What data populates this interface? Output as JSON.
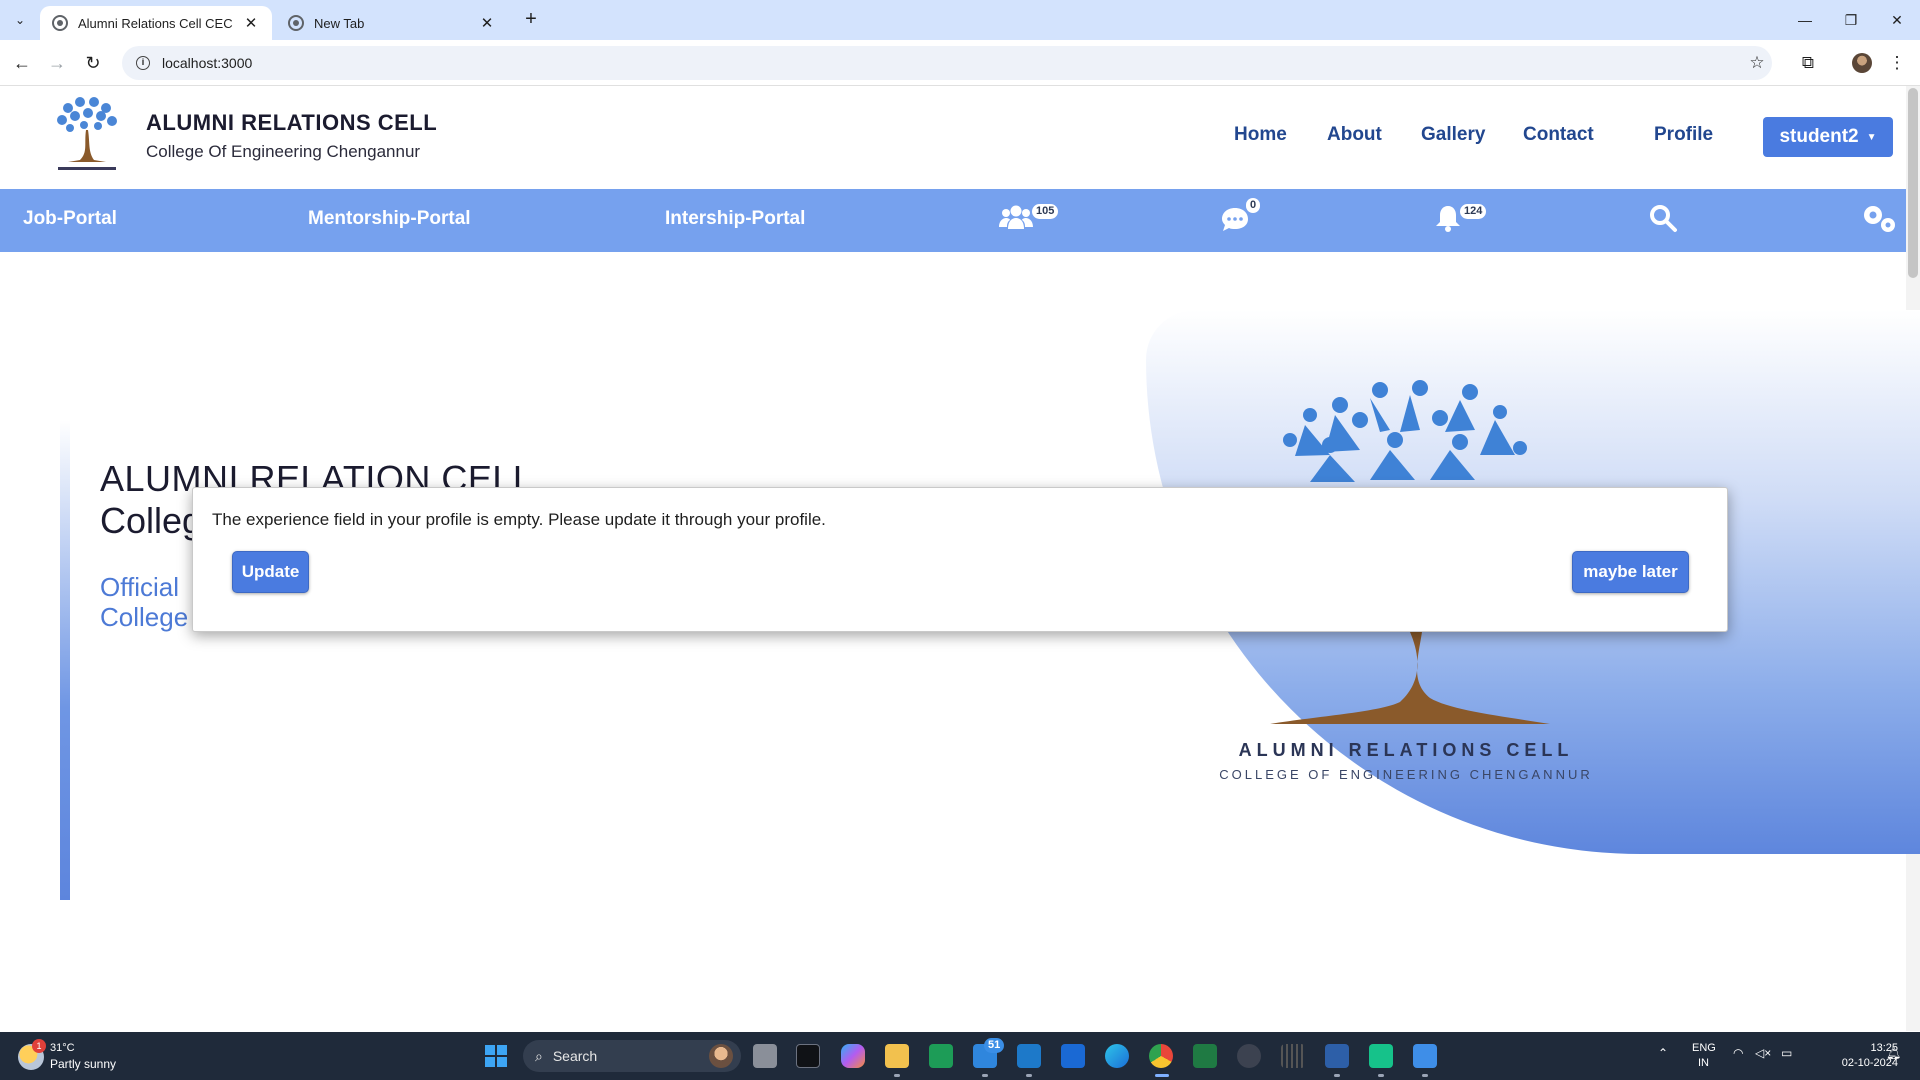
{
  "browser": {
    "tabs": [
      {
        "title": "Alumni Relations Cell CEC",
        "active": true
      },
      {
        "title": "New Tab",
        "active": false
      }
    ],
    "tab_close": "✕",
    "new_tab": "+",
    "url": "localhost:3000",
    "window_controls": {
      "minimize": "—",
      "restore": "❐",
      "close": "✕"
    }
  },
  "site": {
    "brand_title": "ALUMNI RELATIONS CELL",
    "brand_subtitle": "College Of Engineering Chengannur",
    "nav": [
      "Home",
      "About",
      "Gallery",
      "Contact",
      "Profile"
    ],
    "user_button": "student2",
    "portal_links": [
      "Job-Portal",
      "Mentorship-Portal",
      "Intership-Portal"
    ],
    "badges": {
      "connections": "105",
      "messages": "0",
      "notifications": "124"
    }
  },
  "hero": {
    "title": "ALUMNI RELATION CELL",
    "subtitle_partial": "Colleg",
    "desc_line1_partial": "Official",
    "desc_line2_partial": "College",
    "logo_title": "ALUMNI RELATIONS CELL",
    "logo_subtitle": "COLLEGE OF ENGINEERING CHENGANNUR"
  },
  "modal": {
    "message": "The experience field in your profile is empty. Please update it through your profile.",
    "update_button": "Update",
    "later_button": "maybe later"
  },
  "taskbar": {
    "weather_temp": "31°C",
    "weather_condition": "Partly sunny",
    "weather_badge": "1",
    "search_label": "Search",
    "mail_badge": "51",
    "language_line1": "ENG",
    "language_line2": "IN",
    "time": "13:25",
    "date": "02-10-2024"
  },
  "colors": {
    "accent_blue": "#4a7be0",
    "portal_bar": "#76a1ee",
    "nav_text": "#22478f"
  }
}
